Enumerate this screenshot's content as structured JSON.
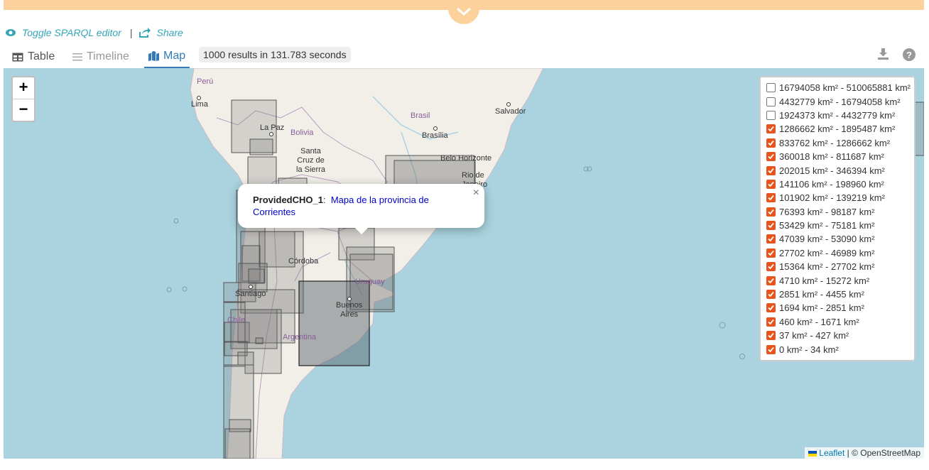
{
  "links": {
    "toggle_editor": "Toggle SPARQL editor",
    "separator": "|",
    "share": "Share"
  },
  "tabs": {
    "table": "Table",
    "timeline": "Timeline",
    "map": "Map"
  },
  "results": "1000 results in 131.783 seconds",
  "zoom": {
    "in": "+",
    "out": "−"
  },
  "popup": {
    "label": "ProvidedCHO_1",
    "sep": ":",
    "link": "Mapa de la provincia de Corrientes",
    "close": "×"
  },
  "legend": [
    {
      "label": "16794058 km² - 510065881 km²",
      "checked": false
    },
    {
      "label": "4432779 km² - 16794058 km²",
      "checked": false
    },
    {
      "label": "1924373 km² - 4432779 km²",
      "checked": false
    },
    {
      "label": "1286662 km² - 1895487 km²",
      "checked": true
    },
    {
      "label": "833762 km² - 1286662 km²",
      "checked": true
    },
    {
      "label": "360018 km² - 811687 km²",
      "checked": true
    },
    {
      "label": "202015 km² - 346394 km²",
      "checked": true
    },
    {
      "label": "141106 km² - 198960 km²",
      "checked": true
    },
    {
      "label": "101902 km² - 139219 km²",
      "checked": true
    },
    {
      "label": "76393 km² - 98187 km²",
      "checked": true
    },
    {
      "label": "53429 km² - 75181 km²",
      "checked": true
    },
    {
      "label": "47039 km² - 53090 km²",
      "checked": true
    },
    {
      "label": "27702 km² - 46989 km²",
      "checked": true
    },
    {
      "label": "15364 km² - 27702 km²",
      "checked": true
    },
    {
      "label": "4710 km² - 15272 km²",
      "checked": true
    },
    {
      "label": "2851 km² - 4455 km²",
      "checked": true
    },
    {
      "label": "1694 km² - 2851 km²",
      "checked": true
    },
    {
      "label": "460 km² - 1671 km²",
      "checked": true
    },
    {
      "label": "37 km² - 427 km²",
      "checked": true
    },
    {
      "label": "0 km² - 34 km²",
      "checked": true
    }
  ],
  "attribution": {
    "leaflet": "Leaflet",
    "rest": "| © OpenStreetMap"
  },
  "map_labels": {
    "peru": "Perú",
    "lima": "Lima",
    "la_paz": "La Paz",
    "bolivia": "Bolivia",
    "santa_cruz": [
      "Santa",
      "Cruz de",
      "la Sierra"
    ],
    "brasil": "Brasil",
    "brasilia": "Brasília",
    "salvador": "Salvador",
    "belo_horizonte": "Belo Horizonte",
    "rio": [
      "Rio de",
      "Janeiro"
    ],
    "cordoba": "Córdoba",
    "santiago": "Santiago",
    "chile": "Chile",
    "uruguay": "Uruguay",
    "buenos_aires": [
      "Buenos",
      "Aires"
    ],
    "argentina": "Argentina"
  },
  "colors": {
    "accent": "#337ab7",
    "banner": "#fdd19b",
    "link": "#36a5b8",
    "check": "#e8541d",
    "water": "#aad3df",
    "land": "#f2efe9"
  }
}
